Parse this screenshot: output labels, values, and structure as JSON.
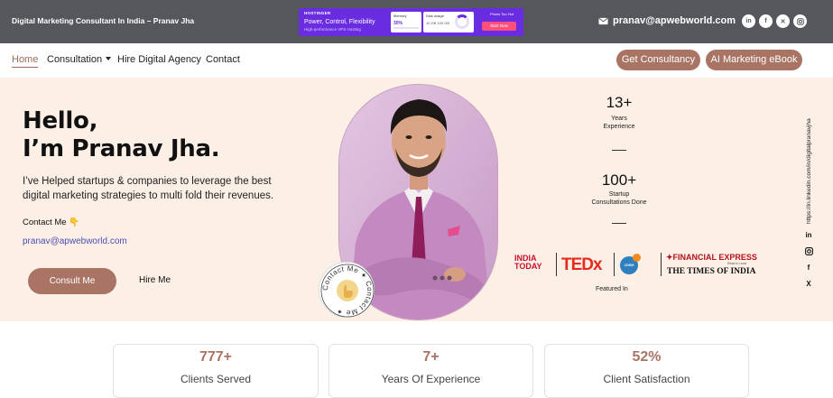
{
  "topbar": {
    "site_name": "Digital Marketing Consultant In India – Pranav Jha",
    "email": "pranav@apwebworld.com",
    "social_icons": [
      "linkedin-icon",
      "facebook-icon",
      "x-icon",
      "instagram-icon"
    ]
  },
  "ad": {
    "brand": "HOSTINGER",
    "headline": "Power, Control, Flexibility",
    "subline": "High-performance VPS Hosting",
    "card1_title": "Memory",
    "card1_value": "30%",
    "card2_title": "Disk usage",
    "card2_values": "10 GB   100 GB",
    "tag": "Prices Too Hot",
    "cta": "Start Now"
  },
  "nav": {
    "items": [
      {
        "label": "Home",
        "active": true
      },
      {
        "label": "Consultation",
        "has_dropdown": true
      },
      {
        "label": "Hire Digital Agency"
      },
      {
        "label": "Contact"
      }
    ],
    "cta_consultancy": "Get Consultancy",
    "cta_ebook": "AI Marketing eBook"
  },
  "hero": {
    "greeting_line1": "Hello,",
    "greeting_line2": "I’m Pranav Jha.",
    "lead": "I’ve Helped startups & companies to leverage the best digital marketing strategies to multi fold their revenues.",
    "contact_label": "Contact Me 👇",
    "email": "pranav@apwebworld.com",
    "btn_consult": "Consult Me",
    "btn_hire": "Hire Me",
    "badge_text": "Contact Me ✦ Contact Me ✦"
  },
  "stats_side": {
    "years_value": "13+",
    "years_label_1": "Years",
    "years_label_2": "Experience",
    "consult_value": "100+",
    "consult_label_1": "Startup",
    "consult_label_2": "Consultations Done"
  },
  "featured": {
    "label": "Featured In",
    "logo_india_1": "INDIA",
    "logo_india_2": "TODAY",
    "logo_ted": "TEDx",
    "logo_josh": "JOSH TALKS",
    "logo_fe": "FINANCIAL EXPRESS",
    "logo_fe_sub": "Read to Lead",
    "logo_toi": "THE TIMES OF INDIA"
  },
  "side": {
    "url": "https://in.linkedin.com/in/digitalpranavjha",
    "icons": [
      "in",
      "ig",
      "f",
      "X"
    ]
  },
  "cards": [
    {
      "value": "777+",
      "label": "Clients Served"
    },
    {
      "value": "7+",
      "label": "Years Of Experience"
    },
    {
      "value": "52%",
      "label": "Client Satisfaction"
    }
  ],
  "colors": {
    "topbar": "#55575c",
    "accent": "#a97464",
    "hero_bg": "#fcefe6",
    "link": "#4a4fb5"
  }
}
